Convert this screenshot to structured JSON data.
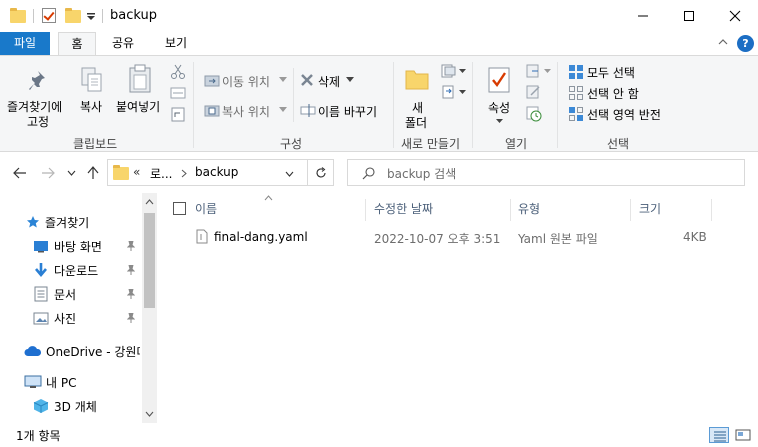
{
  "window": {
    "title": "backup"
  },
  "ribbon_tabs": {
    "file": "파일",
    "home": "홈",
    "share": "공유",
    "view": "보기"
  },
  "help": {
    "label": "?"
  },
  "clipboard_group": {
    "label": "클립보드",
    "pin_line1": "즐겨찾기에",
    "pin_line2": "고정",
    "copy": "복사",
    "paste": "붙여넣기"
  },
  "organize_group": {
    "label": "구성",
    "move_to": "이동 위치",
    "copy_to": "복사 위치",
    "delete": "삭제",
    "rename": "이름 바꾸기"
  },
  "new_group": {
    "label": "새로 만들기",
    "new_folder_line1": "새",
    "new_folder_line2": "폴더"
  },
  "open_group": {
    "label": "열기",
    "properties": "속성"
  },
  "select_group": {
    "label": "선택",
    "select_all": "모두 선택",
    "select_none": "선택 안 함",
    "invert": "선택 영역 반전"
  },
  "address": {
    "overflow": "«",
    "crumb1": "로...",
    "crumb2": "backup"
  },
  "search": {
    "placeholder": "backup 검색"
  },
  "nav": {
    "quick_access": "즐겨찾기",
    "desktop": "바탕 화면",
    "downloads": "다운로드",
    "documents": "문서",
    "pictures": "사진",
    "onedrive": "OneDrive - 강원대",
    "this_pc": "내 PC",
    "objects3d": "3D 개체"
  },
  "columns": {
    "name": "이름",
    "modified": "수정한 날짜",
    "type": "유형",
    "size": "크기"
  },
  "files": [
    {
      "name": "final-dang.yaml",
      "modified": "2022-10-07 오후 3:51",
      "type": "Yaml 원본 파일",
      "size": "4KB"
    }
  ],
  "status": {
    "item_count": "1개 항목"
  },
  "colors": {
    "file_tab": "#1979ca",
    "accent": "#0078d7",
    "folder": "#f8d56b"
  }
}
